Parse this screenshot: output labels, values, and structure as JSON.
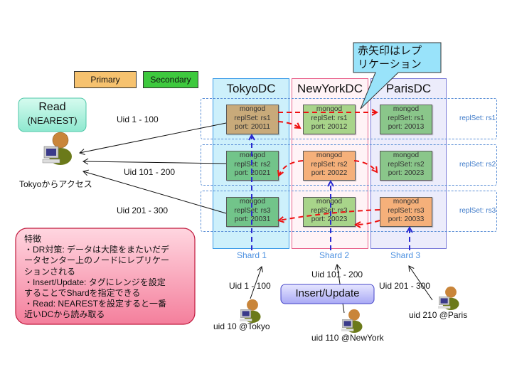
{
  "callout": {
    "line1": "赤矢印はレプ",
    "line2": "リケーション"
  },
  "legend": {
    "primary": "Primary",
    "secondary": "Secondary"
  },
  "colors": {
    "primary": "#f6c26f",
    "secondary": "#3ec93e",
    "node_primary_tokyo": "#c8aa7a",
    "node_primary": "#f5b07a",
    "node_secondary_green": "#72c48a",
    "node_secondary_light": "#a8d48a",
    "replication_arrow": "#ee1111",
    "shard_line": "#2a2ad0"
  },
  "read_box": {
    "title": "Read",
    "subtitle": "(NEAREST)"
  },
  "reader": {
    "label": "Tokyoからアクセス"
  },
  "read_ranges": [
    "Uid 1 - 100",
    "Uid 101 - 200",
    "Uid 201 - 300"
  ],
  "datacenters": [
    {
      "name": "TokyoDC"
    },
    {
      "name": "NewYorkDC"
    },
    {
      "name": "ParisDC"
    }
  ],
  "replsets": [
    {
      "label": "replSet: rs1",
      "nodes": [
        {
          "l1": "mongod",
          "l2": "replSet: rs1",
          "l3": "port: 20011",
          "role": "primary"
        },
        {
          "l1": "mongod",
          "l2": "replSet: rs1",
          "l3": "port: 20012",
          "role": "secondary"
        },
        {
          "l1": "mongod",
          "l2": "replSet: rs1",
          "l3": "port: 20013",
          "role": "secondary"
        }
      ]
    },
    {
      "label": "replSet: rs2",
      "nodes": [
        {
          "l1": "mongod",
          "l2": "replSet: rs2",
          "l3": "port: 20021",
          "role": "secondary"
        },
        {
          "l1": "mongod",
          "l2": "replSet: rs2",
          "l3": "port: 20022",
          "role": "primary"
        },
        {
          "l1": "mongod",
          "l2": "replSet: rs2",
          "l3": "port: 20023",
          "role": "secondary"
        }
      ]
    },
    {
      "label": "replSet: rs3",
      "nodes": [
        {
          "l1": "mongod",
          "l2": "replSet: rs3",
          "l3": "port: 20031",
          "role": "secondary"
        },
        {
          "l1": "mongod",
          "l2": "replSet: rs3",
          "l3": "port: 20023",
          "role": "secondary"
        },
        {
          "l1": "mongod",
          "l2": "replSet: rs3",
          "l3": "port: 20033",
          "role": "primary"
        }
      ]
    }
  ],
  "shards": [
    "Shard 1",
    "Shard 2",
    "Shard 3"
  ],
  "write_ranges": [
    "Uid 1 - 100",
    "Uid 101 - 200",
    "Uid 201 - 300"
  ],
  "insert_box": {
    "label": "Insert/Update"
  },
  "writers": [
    "uid 10 @Tokyo",
    "uid 110 @NewYork",
    "uid 210 @Paris"
  ],
  "features": {
    "title": "特徴",
    "lines": [
      "・DR対策: データは大陸をまたいだデ",
      "ータセンター上のノードにレプリケー",
      "ションされる",
      "・Insert/Update: タグにレンジを設定",
      "することでShardを指定できる",
      "・Read: NEARESTを設定すると一番",
      "近いDCから読み取る"
    ]
  }
}
